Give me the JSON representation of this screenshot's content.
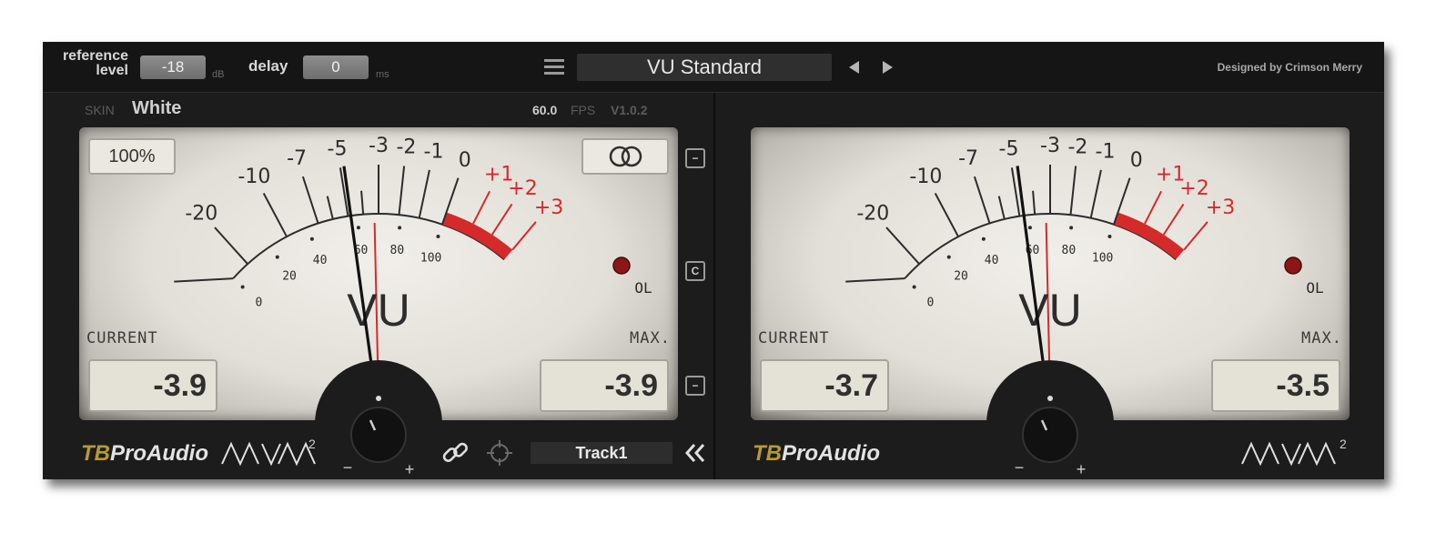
{
  "topbar": {
    "reference_label_line1": "reference",
    "reference_label_line2": "level",
    "reference_value": "-18",
    "reference_unit": "dB",
    "delay_label": "delay",
    "delay_value": "0",
    "delay_unit": "ms",
    "preset_name": "VU Standard",
    "designed_by": "Designed by Crimson Merry",
    "menu_icon": "hamburger-menu-icon",
    "prev_icon": "triangle-left-icon",
    "next_icon": "triangle-right-icon"
  },
  "left_panel": {
    "skin_label": "SKIN",
    "skin_value": "White",
    "fps_value": "60.0",
    "fps_label": "FPS",
    "version": "V1.0.2",
    "zoom_button": "100%",
    "stereo_icon": "stereo-link-icon",
    "current_label": "CURRENT",
    "max_label": "MAX.",
    "current_value": "-3.9",
    "max_value": "-3.9",
    "needle_db": -4.8,
    "brand_tb": "TB",
    "brand_rest": "ProAudio",
    "logo": "MVM²",
    "link_icon": "chain-link-icon",
    "target_icon": "crosshair-icon",
    "track_name": "Track1",
    "collapse_icon": "double-chevron-left-icon"
  },
  "center_strip": {
    "button_top": "−",
    "button_mid": "C",
    "button_bottom": "−"
  },
  "right_panel": {
    "current_label": "CURRENT",
    "max_label": "MAX.",
    "current_value": "-3.7",
    "max_value": "-3.5",
    "needle_db": -4.7,
    "brand_tb": "TB",
    "brand_rest": "ProAudio",
    "logo": "MVM²"
  },
  "scale": {
    "vu_label": "VU",
    "ol_label": "OL",
    "db_marks": [
      {
        "label": "-20",
        "db": -20
      },
      {
        "label": "-10",
        "db": -10
      },
      {
        "label": "-7",
        "db": -7
      },
      {
        "label": "-5",
        "db": -5
      },
      {
        "label": "-3",
        "db": -3
      },
      {
        "label": "-2",
        "db": -2
      },
      {
        "label": "-1",
        "db": -1
      },
      {
        "label": "0",
        "db": 0
      },
      {
        "label": "+1",
        "db": 1
      },
      {
        "label": "+2",
        "db": 2
      },
      {
        "label": "+3",
        "db": 3
      }
    ],
    "minor_db": [
      -4,
      -6
    ],
    "percent_marks": [
      {
        "label": "0",
        "db": -22
      },
      {
        "label": "20",
        "db": -14
      },
      {
        "label": "40",
        "db": -8
      },
      {
        "label": "60",
        "db": -4.4
      },
      {
        "label": "80",
        "db": -1.9
      },
      {
        "label": "100",
        "db": 0
      }
    ],
    "red_start_db": 0,
    "red_end_db": 3,
    "zero_marker_db": -3.3
  },
  "colors": {
    "red": "#d42a2a",
    "ink": "#2c2c2c",
    "brand_gold": "#b99a2f"
  }
}
